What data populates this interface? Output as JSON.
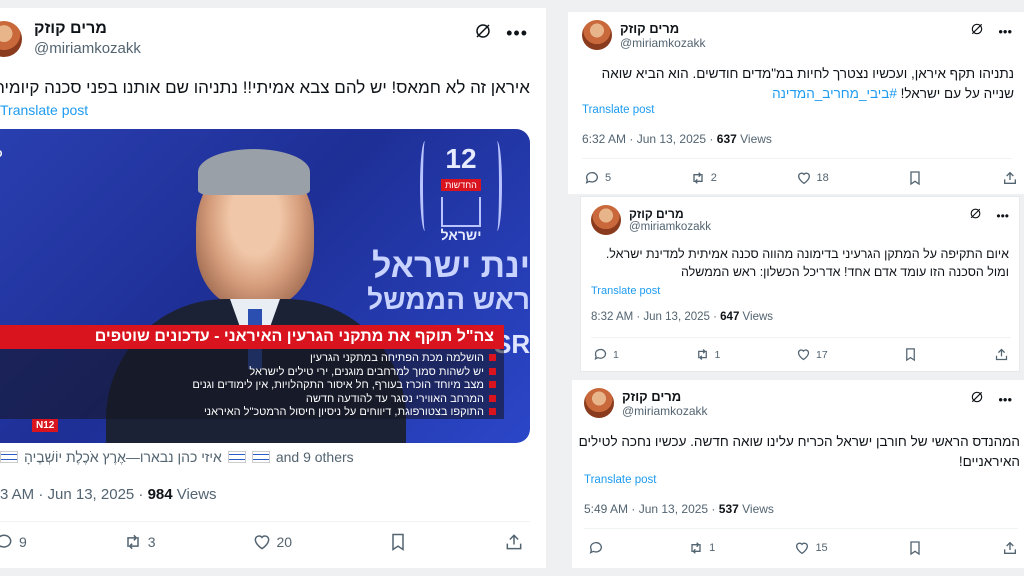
{
  "left_post": {
    "display_name": "מרים קוזק",
    "handle": "@miriamkozakk",
    "text": "איראן זה לא חמאס! יש להם צבא אמיתי!! נתניהו שם אותנו בפני סכנה קיומית!",
    "translate": "Translate post",
    "image": {
      "channel_number": "12",
      "channel_caption": "החדשות",
      "logo_word": "ישראל",
      "backdrop_line1": "ינת ישראל",
      "backdrop_line2": "ראש הממשל",
      "corner_tag": "PO",
      "bottom_tag": "N12",
      "side_text": "SR",
      "headline": "צה\"ל תוקף את מתקני הגרעין האיראני - עדכונים שוטפים",
      "bullets": [
        "הושלמה מכת הפתיחה במתקני הגרעין",
        "יש לשהות סמוך למרחבים מוגנים, ירי טילים לישראל",
        "מצב מיוחד הוכרז בעורף, חל איסור התקהלויות, אין לימודים וגנים",
        "המרחב האווירי נסגר עד להודעה חדשה",
        "התוקפו בצטורפוגת, דיווחים על ניסיון חיסול הרמטכ\"ל האיראני"
      ]
    },
    "tagged": "איזי כהן נבארו—אֶרֶץ אֹכֶלֶת יוֹשְׁבֶיהָ",
    "tagged_more": "and 9 others",
    "time": "3 AM · Jun 13, 2025 ·",
    "views": "984",
    "views_label": "Views",
    "replies": "9",
    "reposts": "3",
    "likes": "20"
  },
  "right_post_1": {
    "display_name": "מרים קוזק",
    "handle": "@miriamkozakk",
    "text_line1": "נתניהו תקף איראן, ועכשיו נצטרך לחיות במ\"מדים חודשים. הוא הביא שואה",
    "text_line2_plain": "שנייה על עם ישראל!",
    "hashtag": "#ביבי_מחריב_המדינה",
    "translate": "Translate post",
    "time": "6:32 AM · Jun 13, 2025 ·",
    "views": "637",
    "views_label": "Views",
    "replies": "5",
    "reposts": "2",
    "likes": "18"
  },
  "right_post_2": {
    "display_name": "מרים קוזק",
    "handle": "@miriamkozakk",
    "text_line1": "איום התקיפה על המתקן הגרעיני בדימונה מהווה סכנה אמיתית למדינת ישראל.",
    "text_line2": "ומול הסכנה הזו עומד אדם אחד! אדריכל הכשלון: ראש הממשלה",
    "translate": "Translate post",
    "time": "8:32 AM · Jun 13, 2025 ·",
    "views": "647",
    "views_label": "Views",
    "replies": "1",
    "reposts": "1",
    "likes": "17"
  },
  "right_post_3": {
    "display_name": "מרים קוזק",
    "handle": "@miriamkozakk",
    "text_line1": "המהנדס הראשי של חורבן ישראל הכריח עלינו שואה חדשה. עכשיו נחכה לטילים",
    "text_line2": "האיראניים!",
    "translate": "Translate post",
    "time": "5:49 AM · Jun 13, 2025 ·",
    "views": "537",
    "views_label": "Views",
    "replies": "",
    "reposts": "1",
    "likes": "15"
  },
  "colors": {
    "accent": "#1d9bf0",
    "muted": "#536471",
    "banner_red": "#d9141f"
  }
}
